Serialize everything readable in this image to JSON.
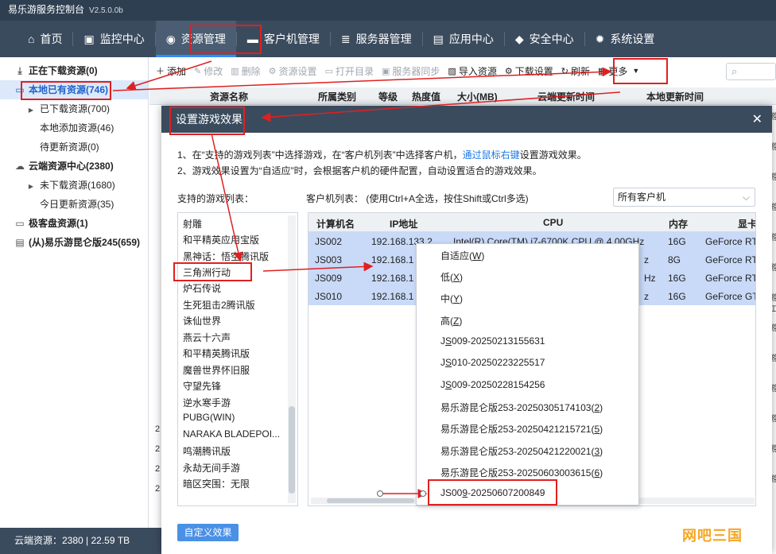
{
  "app": {
    "title": "易乐游服务控制台",
    "version": "V2.5.0.0b"
  },
  "nav": [
    {
      "icon": "home-icon",
      "glyph": "⌂",
      "label": "首页"
    },
    {
      "icon": "monitor-icon",
      "glyph": "▣",
      "label": "监控中心"
    },
    {
      "icon": "gamepad-icon",
      "glyph": "◉",
      "label": "资源管理"
    },
    {
      "icon": "desktop-icon",
      "glyph": "▬",
      "label": "客户机管理"
    },
    {
      "icon": "server-icon",
      "glyph": "≣",
      "label": "服务器管理"
    },
    {
      "icon": "app-center-icon",
      "glyph": "▤",
      "label": "应用中心"
    },
    {
      "icon": "shield-icon",
      "glyph": "◆",
      "label": "安全中心"
    },
    {
      "icon": "gear-icon",
      "glyph": "✹",
      "label": "系统设置"
    }
  ],
  "sidebar": {
    "items": [
      {
        "label": "正在下载资源(0)"
      },
      {
        "label": "本地已有资源(746)"
      },
      {
        "label": "已下载资源(700)"
      },
      {
        "label": "本地添加资源(46)"
      },
      {
        "label": "待更新资源(0)"
      },
      {
        "label": "云端资源中心(2380)"
      },
      {
        "label": "未下载资源(1680)"
      },
      {
        "label": "今日更新资源(35)"
      },
      {
        "label": "极客盘资源(1)"
      },
      {
        "label": "(从)易乐游昆仑版245(659)"
      }
    ]
  },
  "footer": {
    "text": "云端资源：2380 | 22.59 TB"
  },
  "toolbar": {
    "add": "添加",
    "edit": "修改",
    "delete": "删除",
    "res_settings": "资源设置",
    "open_dir": "打开目录",
    "server_sync": "服务器同步",
    "import": "导入资源",
    "download_settings": "下载设置",
    "refresh": "刷新",
    "more": "更多"
  },
  "grid": {
    "columns": [
      "资源名称",
      "所属类别",
      "等级",
      "热度值",
      "大小(MB)",
      "云端更新时间",
      "本地更新时间"
    ]
  },
  "background_letters": [
    "2",
    "2",
    "2",
    "2"
  ],
  "right_strip": [
    "游",
    "游",
    "游",
    "游",
    "游",
    "游",
    "游",
    "游",
    "游",
    "工",
    "游",
    "游",
    "游",
    "游"
  ],
  "dialog": {
    "title": "设置游戏效果",
    "instruction1_a": "1、在“支持的游戏列表”中选择游戏，在“客户机列表”中选择客户机，",
    "instruction1_link": "通过鼠标右键",
    "instruction1_b": "设置游戏效果。",
    "instruction2": "2、游戏效果设置为“自适应”时，会根据客户机的硬件配置，自动设置适合的游戏效果。",
    "games_label": "支持的游戏列表：",
    "clients_label": "客户机列表：  (使用Ctrl+A全选，按住Shift或Ctrl多选)",
    "client_filter": "所有客户机",
    "games": [
      "射雕",
      "和平精英应用宝版",
      "黑神话：悟空腾讯版",
      "三角洲行动",
      "炉石传说",
      "生死狙击2腾讯版",
      "诛仙世界",
      "燕云十六声",
      "和平精英腾讯版",
      "魔兽世界怀旧服",
      "守望先锋",
      "逆水寒手游",
      "PUBG(WIN)",
      "NARAKA BLADEPOI...",
      "鸣潮腾讯版",
      "永劫无间手游",
      "暗区突围：无限"
    ],
    "client_columns": [
      "计算机名",
      "IP地址",
      "CPU",
      "内存",
      "显卡"
    ],
    "clients": [
      {
        "name": "JS002",
        "ip": "192.168.133.2",
        "cpu": "Intel(R) Core(TM) i7-6700K CPU @ 4.00GHz",
        "cpu_tail": "",
        "mem": "16G",
        "gpu": "GeForce RT"
      },
      {
        "name": "JS003",
        "ip": "192.168.1",
        "cpu": "",
        "cpu_tail": "z",
        "mem": "8G",
        "gpu": "GeForce RT"
      },
      {
        "name": "JS009",
        "ip": "192.168.1",
        "cpu": "",
        "cpu_tail": "Hz",
        "mem": "16G",
        "gpu": "GeForce RT"
      },
      {
        "name": "JS010",
        "ip": "192.168.1",
        "cpu": "",
        "cpu_tail": "z",
        "mem": "16G",
        "gpu": "GeForce GT"
      }
    ],
    "custom_button": "自定义效果"
  },
  "context_menu": [
    {
      "text": "自适应(",
      "key": "W",
      "tail": ")"
    },
    {
      "text": "低(",
      "key": "X",
      "tail": ")"
    },
    {
      "text": "中(",
      "key": "Y",
      "tail": ")"
    },
    {
      "text": "高(",
      "key": "Z",
      "tail": ")"
    },
    {
      "text": "J",
      "key": "S",
      "tail": "009-20250213155631"
    },
    {
      "text": "J",
      "key": "S",
      "tail": "010-20250223225517"
    },
    {
      "text": "J",
      "key": "S",
      "tail": "009-20250228154256"
    },
    {
      "text": "易乐游昆仑版253-20250305174103(",
      "key": "2",
      "tail": ")"
    },
    {
      "text": "易乐游昆仑版253-20250421215721(",
      "key": "5",
      "tail": ")"
    },
    {
      "text": "易乐游昆仑版253-20250421220021(",
      "key": "3",
      "tail": ")"
    },
    {
      "text": "易乐游昆仑版253-20250603003615(",
      "key": "6",
      "tail": ")"
    },
    {
      "text": "JS00",
      "key": "9",
      "tail": "-20250607200849"
    }
  ],
  "watermark": "网吧三国",
  "colors": {
    "annotation": "#e02020",
    "nav_bg": "#3b4b5e",
    "selection": "#c9daf8",
    "link": "#1e78e6"
  }
}
